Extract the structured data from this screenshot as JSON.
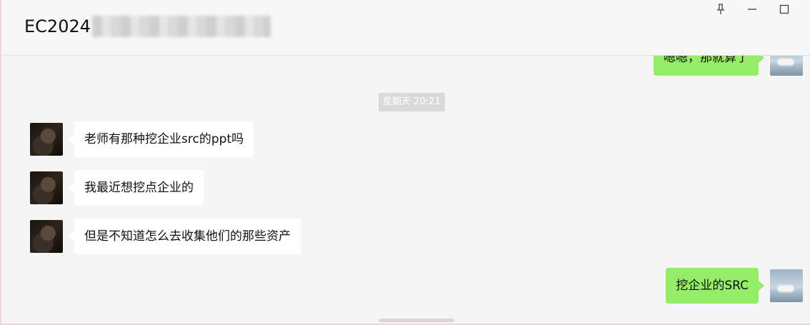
{
  "window": {
    "title": "EC2024",
    "pin_icon": "pin-icon",
    "minimize_icon": "minimize-icon",
    "maximize_icon": "maximize-icon"
  },
  "messages": {
    "top_partial": "嗯嗯，那就算了",
    "timestamp": "星期天 20:21",
    "incoming": [
      {
        "text": "老师有那种挖企业src的ppt吗"
      },
      {
        "text": "我最近想挖点企业的"
      },
      {
        "text": "但是不知道怎么去收集他们的那些资产"
      }
    ],
    "outgoing_last": "挖企业的SRC"
  }
}
